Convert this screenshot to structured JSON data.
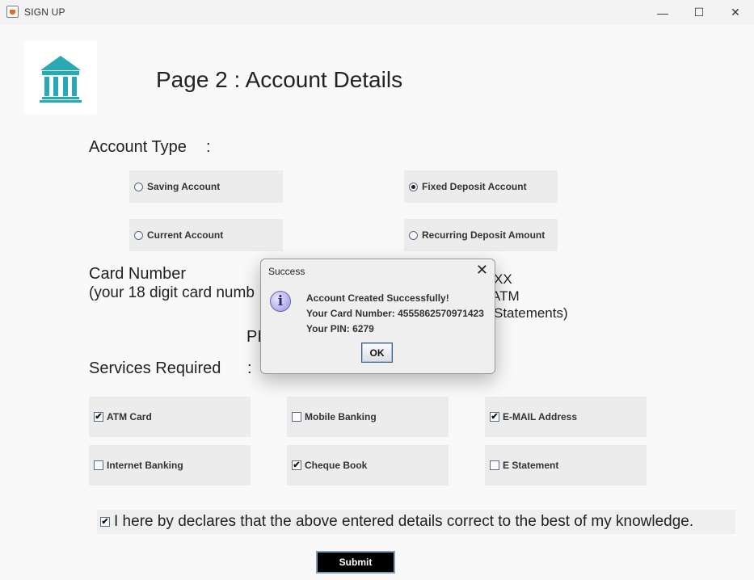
{
  "window": {
    "title": "SIGN UP",
    "minimize": "—",
    "maximize": "☐",
    "close": "✕"
  },
  "page": {
    "heading": "Page 2 : Account Details"
  },
  "account_type": {
    "label": "Account Type",
    "colon": ":",
    "options": [
      {
        "label": "Saving Account",
        "selected": false
      },
      {
        "label": "Fixed Deposit Account",
        "selected": true
      },
      {
        "label": "Current Account",
        "selected": false
      },
      {
        "label": "Recurring Deposit Amount",
        "selected": false
      }
    ]
  },
  "card": {
    "label": "Card Number",
    "hint": "(your 18 digit card numb",
    "right_line1": "XX",
    "right_line2": "ATM",
    "right_line3": "Statements)",
    "pin_fragment": "PI"
  },
  "services": {
    "label": "Services Required",
    "colon": ":",
    "items": [
      {
        "label": "ATM Card",
        "checked": true
      },
      {
        "label": "Mobile Banking",
        "checked": false
      },
      {
        "label": "E-MAIL Address",
        "checked": true
      },
      {
        "label": "Internet Banking",
        "checked": false
      },
      {
        "label": "Cheque Book",
        "checked": true
      },
      {
        "label": "E Statement",
        "checked": false
      }
    ]
  },
  "declaration": {
    "text": "I here by declares that the above entered details correct to the best of my knowledge.",
    "checked": true
  },
  "submit_label": "Submit",
  "dialog": {
    "title": "Success",
    "close": "✕",
    "icon": "i",
    "line1": "Account Created Successfully!",
    "line2": "Your Card Number: 4555862570971423",
    "line3": "Your PIN: 6279",
    "ok_label": "OK"
  },
  "icons": {
    "logo": "bank-building-icon",
    "app": "java-cup-icon",
    "dialog": "information-icon"
  },
  "colors": {
    "logo_teal": "#29a9b3",
    "submit_bg": "#000000"
  }
}
